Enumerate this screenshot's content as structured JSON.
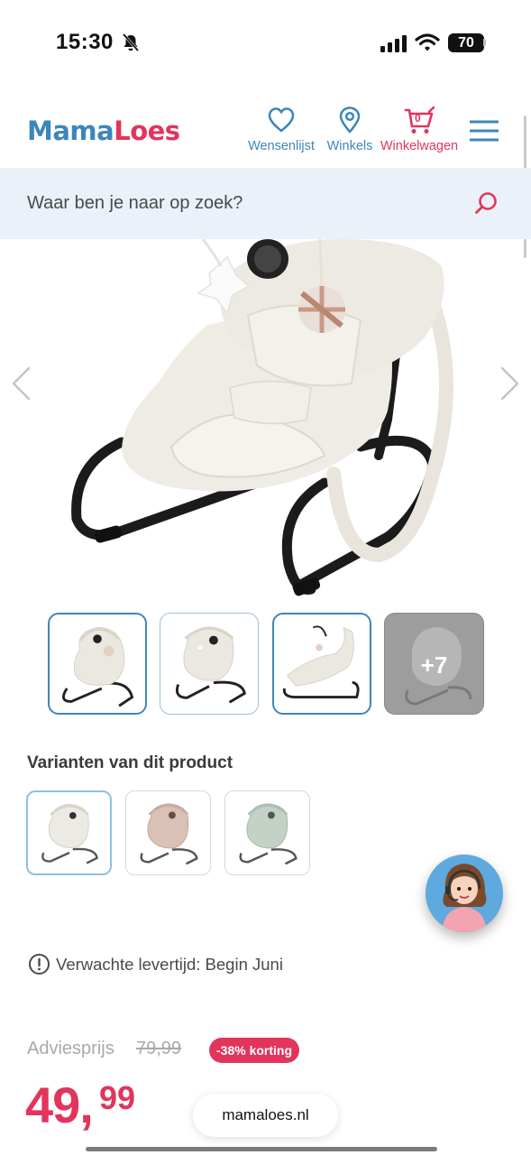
{
  "status_bar": {
    "time": "15:30",
    "battery": "70"
  },
  "header": {
    "logo_part1": "Mama",
    "logo_part2": "Loes",
    "nav": {
      "wishlist_label": "Wensenlijst",
      "stores_label": "Winkels",
      "cart_label": "Winkelwagen",
      "cart_count": "0"
    }
  },
  "search": {
    "placeholder": "Waar ben je naar op zoek?"
  },
  "gallery": {
    "more_label": "+7"
  },
  "variants": {
    "title": "Varianten van dit product"
  },
  "delivery": {
    "text": "Verwachte levertijd: Begin Juni"
  },
  "price": {
    "advies_label": "Adviesprijs",
    "advies_value": "79,99",
    "discount_badge": "-38% korting",
    "current_main": "49,",
    "current_cents": "99"
  },
  "browser": {
    "url": "mamaloes.nl"
  },
  "colors": {
    "brand_blue": "#3d86bb",
    "brand_pink": "#e2355c",
    "search_bg": "#eaf1f8"
  },
  "icons": [
    "bell-muted-icon",
    "signal-icon",
    "wifi-icon",
    "heart-icon",
    "location-pin-icon",
    "cart-icon",
    "menu-icon",
    "search-icon",
    "chevron-left-icon",
    "chevron-right-icon",
    "info-icon"
  ]
}
